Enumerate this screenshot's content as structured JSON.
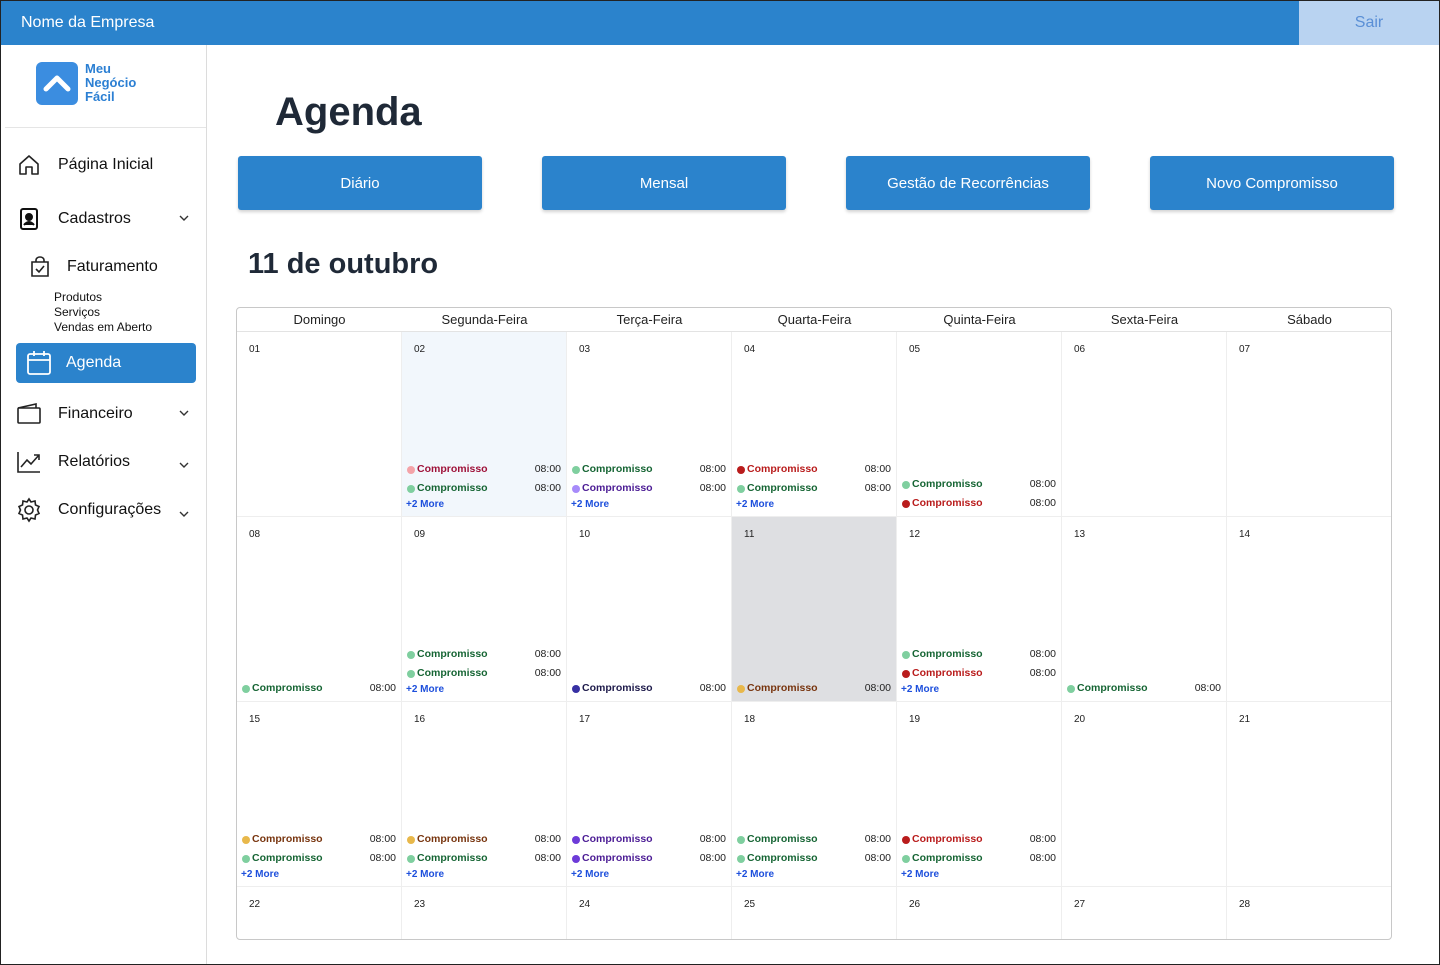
{
  "topbar": {
    "company": "Nome da Empresa",
    "logout": "Sair"
  },
  "logo": {
    "line1": "Meu",
    "line2": "Negócio",
    "line3": "Fácil"
  },
  "sidebar": {
    "home": "Página Inicial",
    "cadastros": "Cadastros",
    "faturamento": "Faturamento",
    "sub": [
      "Produtos",
      "Serviços",
      "Vendas em Aberto"
    ],
    "agenda": "Agenda",
    "financeiro": "Financeiro",
    "relatorios": "Relatórios",
    "config": "Configurações"
  },
  "page": {
    "title": "Agenda",
    "date": "11 de outubro"
  },
  "buttons": [
    "Diário",
    "Mensal",
    "Gestão de Recorrências",
    "Novo Compromisso"
  ],
  "weekdays": [
    "Domingo",
    "Segunda-Feira",
    "Terça-Feira",
    "Quarta-Feira",
    "Quinta-Feira",
    "Sexta-Feira",
    "Sábado"
  ],
  "colors": {
    "green": "#7fcf9f",
    "red": "#b91c1c",
    "pink": "#f4a3a8",
    "purple": "#a78bfa",
    "blue": "#3730a3",
    "yellow": "#e8b84b",
    "violet": "#6d3bd8"
  },
  "more_label": "+2 More",
  "weeks": [
    [
      {
        "day": "01",
        "events": []
      },
      {
        "day": "02",
        "state": "selected",
        "events": [
          {
            "name": "Compromisso",
            "time": "08:00",
            "color": "pink"
          },
          {
            "name": "Compromisso",
            "time": "08:00",
            "color": "green"
          }
        ],
        "more": true
      },
      {
        "day": "03",
        "events": [
          {
            "name": "Compromisso",
            "time": "08:00",
            "color": "green"
          },
          {
            "name": "Compromisso",
            "time": "08:00",
            "color": "purple"
          }
        ],
        "more": true
      },
      {
        "day": "04",
        "events": [
          {
            "name": "Compromisso",
            "time": "08:00",
            "color": "red"
          },
          {
            "name": "Compromisso",
            "time": "08:00",
            "color": "green"
          }
        ],
        "more": true
      },
      {
        "day": "05",
        "events": [
          {
            "name": "Compromisso",
            "time": "08:00",
            "color": "green"
          },
          {
            "name": "Compromisso",
            "time": "08:00",
            "color": "red"
          }
        ]
      },
      {
        "day": "06",
        "events": []
      },
      {
        "day": "07",
        "events": []
      }
    ],
    [
      {
        "day": "08",
        "events": [
          {
            "name": "Compromisso",
            "time": "08:00",
            "color": "green"
          }
        ]
      },
      {
        "day": "09",
        "events": [
          {
            "name": "Compromisso",
            "time": "08:00",
            "color": "green"
          },
          {
            "name": "Compromisso",
            "time": "08:00",
            "color": "green"
          }
        ],
        "more": true
      },
      {
        "day": "10",
        "events": [
          {
            "name": "Compromisso",
            "time": "08:00",
            "color": "blue"
          }
        ]
      },
      {
        "day": "11",
        "state": "today",
        "events": [
          {
            "name": "Compromisso",
            "time": "08:00",
            "color": "yellow"
          }
        ]
      },
      {
        "day": "12",
        "events": [
          {
            "name": "Compromisso",
            "time": "08:00",
            "color": "green"
          },
          {
            "name": "Compromisso",
            "time": "08:00",
            "color": "red"
          }
        ],
        "more": true
      },
      {
        "day": "13",
        "events": [
          {
            "name": "Compromisso",
            "time": "08:00",
            "color": "green"
          }
        ]
      },
      {
        "day": "14",
        "events": []
      }
    ],
    [
      {
        "day": "15",
        "events": [
          {
            "name": "Compromisso",
            "time": "08:00",
            "color": "yellow"
          },
          {
            "name": "Compromisso",
            "time": "08:00",
            "color": "green"
          }
        ],
        "more": true
      },
      {
        "day": "16",
        "events": [
          {
            "name": "Compromisso",
            "time": "08:00",
            "color": "yellow"
          },
          {
            "name": "Compromisso",
            "time": "08:00",
            "color": "green"
          }
        ],
        "more": true
      },
      {
        "day": "17",
        "events": [
          {
            "name": "Compromisso",
            "time": "08:00",
            "color": "violet"
          },
          {
            "name": "Compromisso",
            "time": "08:00",
            "color": "violet"
          }
        ],
        "more": true
      },
      {
        "day": "18",
        "events": [
          {
            "name": "Compromisso",
            "time": "08:00",
            "color": "green"
          },
          {
            "name": "Compromisso",
            "time": "08:00",
            "color": "green"
          }
        ],
        "more": true
      },
      {
        "day": "19",
        "events": [
          {
            "name": "Compromisso",
            "time": "08:00",
            "color": "red"
          },
          {
            "name": "Compromisso",
            "time": "08:00",
            "color": "green"
          }
        ],
        "more": true
      },
      {
        "day": "20",
        "events": []
      },
      {
        "day": "21",
        "events": []
      }
    ],
    [
      {
        "day": "22",
        "events": []
      },
      {
        "day": "23",
        "events": []
      },
      {
        "day": "24",
        "events": []
      },
      {
        "day": "25",
        "events": []
      },
      {
        "day": "26",
        "events": []
      },
      {
        "day": "27",
        "events": []
      },
      {
        "day": "28",
        "events": []
      }
    ]
  ]
}
